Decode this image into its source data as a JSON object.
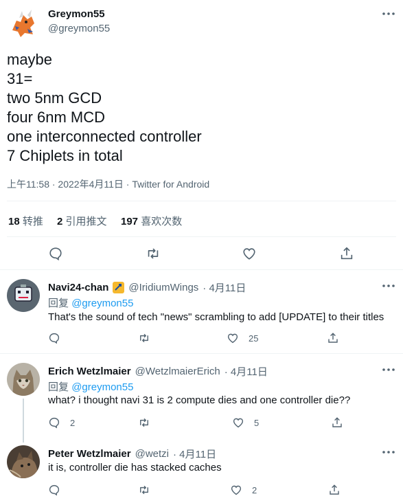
{
  "main_tweet": {
    "name": "Greymon55",
    "handle": "@greymon55",
    "lines": [
      "maybe",
      "31=",
      "two 5nm GCD",
      "four 6nm MCD",
      "one interconnected controller",
      "7 Chiplets in total"
    ],
    "meta": "上午11:58 · 2022年4月11日 · Twitter for Android",
    "retweets": "18",
    "retweets_label": "转推",
    "quotes": "2",
    "quotes_label": "引用推文",
    "likes": "197",
    "likes_label": "喜欢次数"
  },
  "replies": [
    {
      "name": "Navi24-chan",
      "handle": "@IridiumWings",
      "date": "· 4月11日",
      "reply_prefix": "回复",
      "reply_to": "@greymon55",
      "text": "That's the sound of tech \"news\" scrambling to add [UPDATE] to their titles",
      "reply_count": "",
      "like_count": "25"
    },
    {
      "name": "Erich Wetzlmaier",
      "handle": "@WetzlmaierErich",
      "date": "· 4月11日",
      "reply_prefix": "回复",
      "reply_to": "@greymon55",
      "text": "what? i thought navi 31 is 2 compute dies and one controller die??",
      "reply_count": "2",
      "like_count": "5"
    },
    {
      "name": "Peter Wetzlmaier",
      "handle": "@wetzi",
      "date": "· 4月11日",
      "text": "it is, controller die has stacked caches",
      "reply_count": "",
      "like_count": "2"
    }
  ],
  "colors": {
    "accent": "#1d9bf0",
    "muted": "#536471",
    "text": "#0f1419",
    "border": "#eff3f4"
  }
}
